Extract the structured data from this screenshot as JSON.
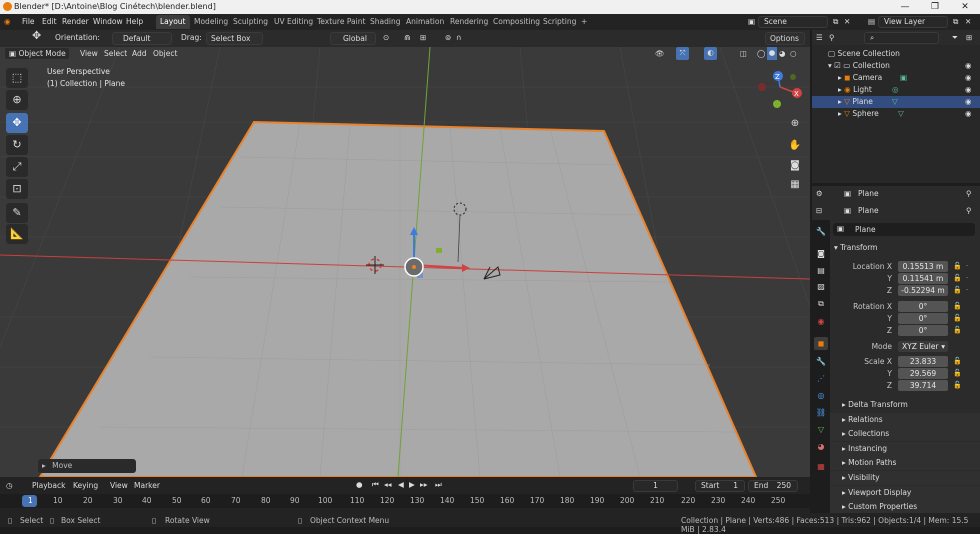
{
  "window": {
    "title": "Blender* [D:\\Antoine\\Blog Cinétech\\blender.blend]",
    "minimize": "—",
    "maximize": "❐",
    "close": "✕"
  },
  "menu": [
    "File",
    "Edit",
    "Render",
    "Window",
    "Help"
  ],
  "workspaces": [
    "Layout",
    "Modeling",
    "Sculpting",
    "UV Editing",
    "Texture Paint",
    "Shading",
    "Animation",
    "Rendering",
    "Compositing",
    "Scripting"
  ],
  "workspace_add": "+",
  "scene": {
    "label": "Scene"
  },
  "view_layer": {
    "label": "View Layer"
  },
  "header": {
    "orientation_label": "Orientation:",
    "orientation_value": "Default",
    "drag_label": "Drag:",
    "drag_value": "Select Box",
    "transform_orientation": "Global",
    "options": "Options"
  },
  "mode": {
    "label": "Object Mode",
    "view": "View",
    "select": "Select",
    "add": "Add",
    "object": "Object"
  },
  "viewport": {
    "perspective": "User Perspective",
    "context": "(1) Collection | Plane",
    "move_panel": "Move"
  },
  "gizmo": {
    "x": "X",
    "y": "Y",
    "z": "Z"
  },
  "outliner": {
    "root": "Scene Collection",
    "collection": "Collection",
    "objects": [
      {
        "name": "Camera",
        "color": "#e87d0d"
      },
      {
        "name": "Light",
        "color": "#e87d0d"
      },
      {
        "name": "Plane",
        "color": "#e87d0d"
      },
      {
        "name": "Sphere",
        "color": "#e87d0d"
      }
    ]
  },
  "properties": {
    "object_name_top": "Plane",
    "object_name_data": "Plane",
    "object_name_field": "Plane",
    "transform": "Transform",
    "location_label": "Location X",
    "location": [
      "0.15513 m",
      "0.11541 m",
      "-0.52294 m"
    ],
    "rotation_label": "Rotation X",
    "rotation": [
      "0°",
      "0°",
      "0°"
    ],
    "mode_label": "Mode",
    "mode_value": "XYZ Euler",
    "scale_label": "Scale X",
    "scale": [
      "23.833",
      "29.569",
      "39.714"
    ],
    "axis_y": "Y",
    "axis_z": "Z",
    "sections": [
      "Delta Transform",
      "Relations",
      "Collections",
      "Instancing",
      "Motion Paths",
      "Visibility",
      "Viewport Display",
      "Custom Properties"
    ]
  },
  "timeline": {
    "playback": "Playback",
    "keying": "Keying",
    "view": "View",
    "marker": "Marker",
    "current_frame": "1",
    "start_label": "Start",
    "start": "1",
    "end_label": "End",
    "end": "250",
    "ticks": [
      "1",
      "10",
      "20",
      "30",
      "40",
      "50",
      "60",
      "70",
      "80",
      "90",
      "100",
      "110",
      "120",
      "130",
      "140",
      "150",
      "160",
      "170",
      "180",
      "190",
      "200",
      "210",
      "220",
      "230",
      "240",
      "250"
    ]
  },
  "status": {
    "select": "Select",
    "box_select": "Box Select",
    "rotate_view": "Rotate View",
    "context_menu": "Object Context Menu",
    "info": "Collection | Plane | Verts:486 | Faces:513 | Tris:962 | Objects:1/4 | Mem: 15.5 MiB | 2.83.4"
  },
  "colors": {
    "accent": "#4772b3",
    "selection": "#e87d0d",
    "x_axis": "#d14343",
    "y_axis": "#7fb02c",
    "z_axis": "#3e7be0"
  }
}
